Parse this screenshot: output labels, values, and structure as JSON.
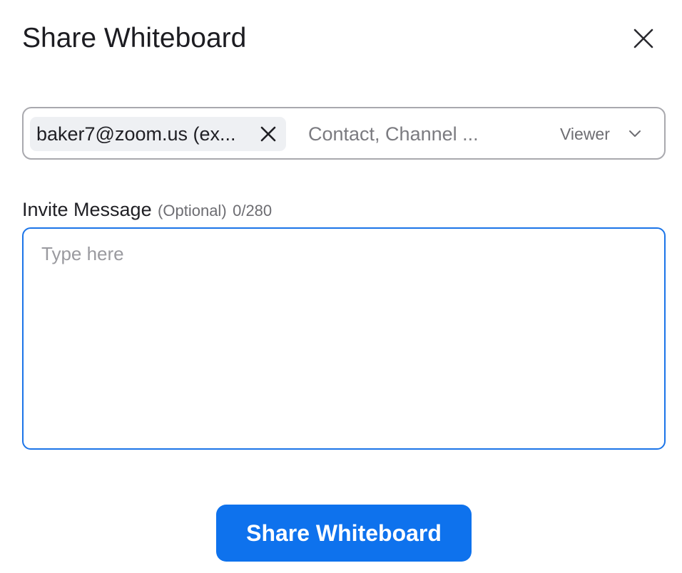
{
  "dialog": {
    "title": "Share Whiteboard",
    "close_icon": "close-icon"
  },
  "recipients": {
    "chips": [
      {
        "label": "baker7@zoom.us (ex...",
        "remove_icon": "close-icon"
      }
    ],
    "input_placeholder": "Contact, Channel ...",
    "input_value": "",
    "role": {
      "selected": "Viewer",
      "icon": "chevron-down-icon"
    }
  },
  "invite_message": {
    "label": "Invite Message",
    "optional_label": "(Optional)",
    "counter": "0/280",
    "placeholder": "Type here",
    "value": ""
  },
  "actions": {
    "share_label": "Share Whiteboard"
  },
  "colors": {
    "accent": "#0e72ed",
    "focus_border": "#1b74e8",
    "chip_background": "#eef0f3"
  }
}
